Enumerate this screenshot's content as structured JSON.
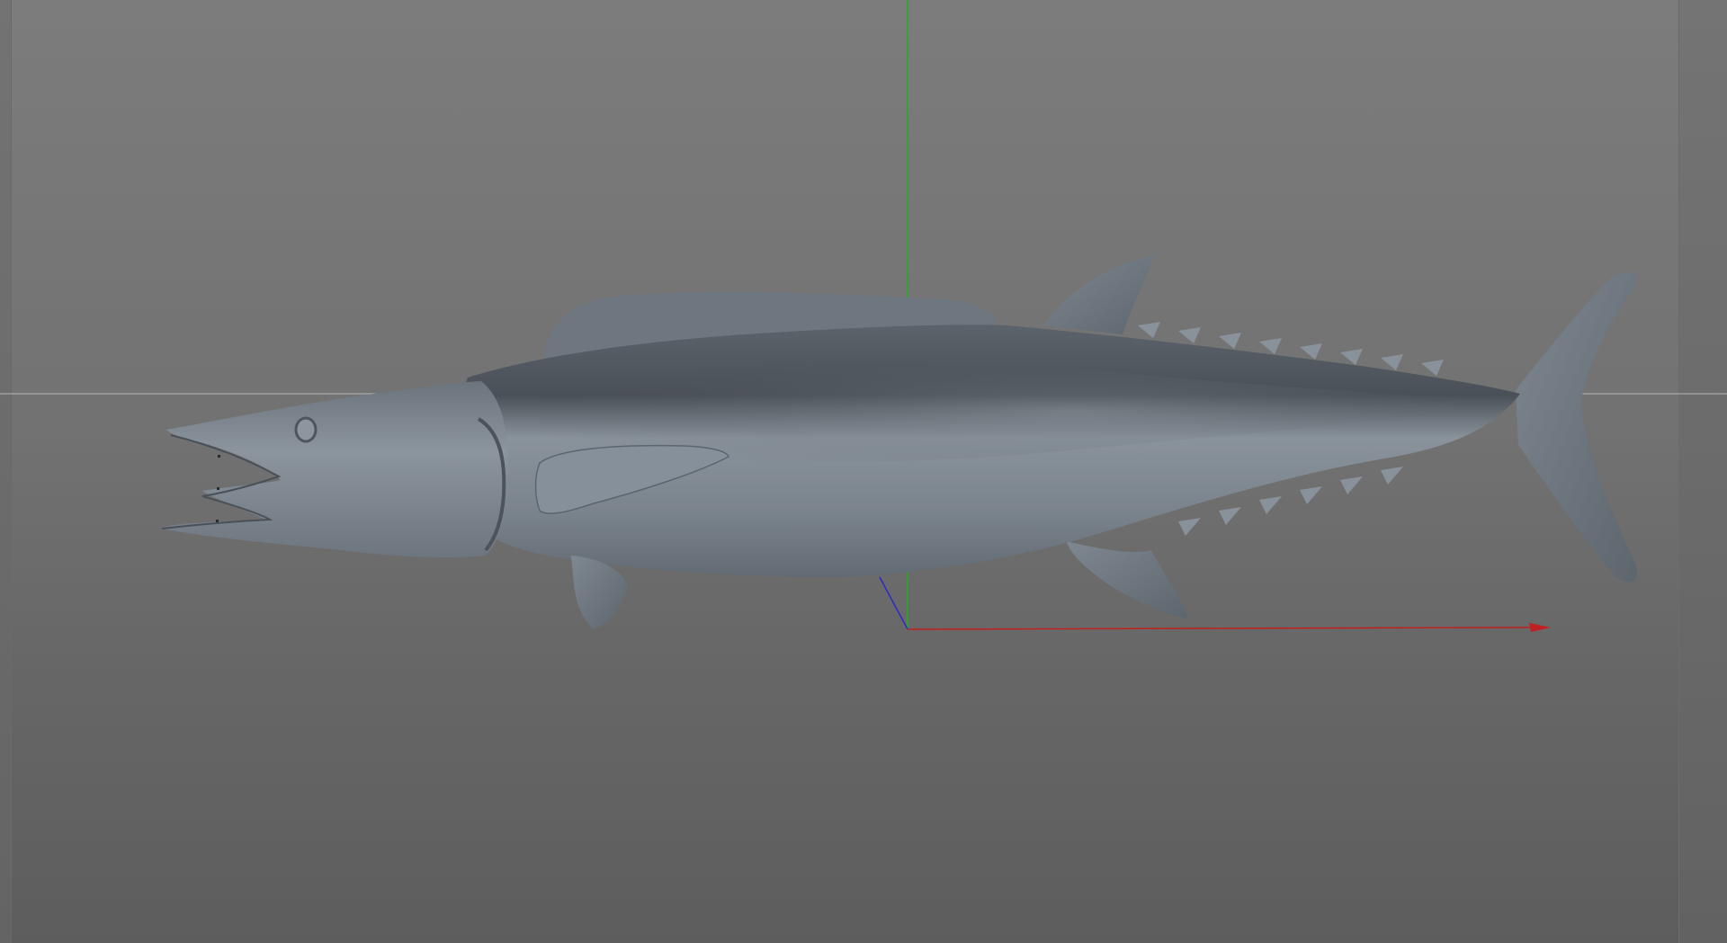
{
  "viewport": {
    "background_top": "#7c7c7c",
    "background_bottom": "#5d5d5d"
  },
  "axes": {
    "x_color": "#c02020",
    "y_color": "#20b020",
    "z_color": "#2020c0",
    "horizon_color": "#b8b8b8"
  },
  "model": {
    "icon": "fish-model-icon",
    "body_color": "#7d8690"
  }
}
